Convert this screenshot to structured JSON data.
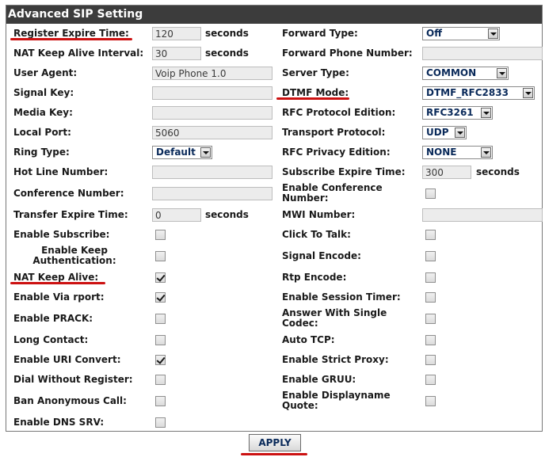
{
  "title": "Advanced SIP Setting",
  "left": {
    "register_expire_time": {
      "label": "Register Expire Time:",
      "value": "120",
      "unit": "seconds"
    },
    "nat_keep_alive_interval": {
      "label": "NAT Keep Alive Interval:",
      "value": "30",
      "unit": "seconds"
    },
    "user_agent": {
      "label": "User Agent:",
      "value": "Voip Phone 1.0"
    },
    "signal_key": {
      "label": "Signal Key:",
      "value": ""
    },
    "media_key": {
      "label": "Media Key:",
      "value": ""
    },
    "local_port": {
      "label": "Local Port:",
      "value": "5060"
    },
    "ring_type": {
      "label": "Ring Type:",
      "value": "Default"
    },
    "hot_line_number": {
      "label": "Hot Line Number:",
      "value": ""
    },
    "conference_number": {
      "label": "Conference Number:",
      "value": ""
    },
    "transfer_expire_time": {
      "label": "Transfer Expire Time:",
      "value": "0",
      "unit": "seconds"
    },
    "enable_subscribe": {
      "label": "Enable Subscribe:",
      "checked": false
    },
    "enable_keep_authentication": {
      "label": "Enable Keep Authentication:",
      "checked": false
    },
    "nat_keep_alive": {
      "label": "NAT Keep Alive:",
      "checked": true
    },
    "enable_via_rport": {
      "label": "Enable Via rport:",
      "checked": true
    },
    "enable_prack": {
      "label": "Enable PRACK:",
      "checked": false
    },
    "long_contact": {
      "label": "Long Contact:",
      "checked": false
    },
    "enable_uri_convert": {
      "label": "Enable URI Convert:",
      "checked": true
    },
    "dial_without_register": {
      "label": "Dial Without Register:",
      "checked": false
    },
    "ban_anonymous_call": {
      "label": "Ban Anonymous Call:",
      "checked": false
    },
    "enable_dns_srv": {
      "label": "Enable DNS SRV:",
      "checked": false
    }
  },
  "right": {
    "forward_type": {
      "label": "Forward Type:",
      "value": "Off"
    },
    "forward_phone_number": {
      "label": "Forward Phone Number:",
      "value": ""
    },
    "server_type": {
      "label": "Server Type:",
      "value": "COMMON"
    },
    "dtmf_mode": {
      "label": "DTMF Mode:",
      "value": "DTMF_RFC2833"
    },
    "rfc_protocol_edition": {
      "label": "RFC Protocol Edition:",
      "value": "RFC3261"
    },
    "transport_protocol": {
      "label": "Transport Protocol:",
      "value": "UDP"
    },
    "rfc_privacy_edition": {
      "label": "RFC Privacy Edition:",
      "value": "NONE"
    },
    "subscribe_expire_time": {
      "label": "Subscribe Expire Time:",
      "value": "300",
      "unit": "seconds"
    },
    "enable_conference_number": {
      "label": "Enable Conference Number:",
      "checked": false
    },
    "mwi_number": {
      "label": "MWI Number:",
      "value": ""
    },
    "click_to_talk": {
      "label": "Click To Talk:",
      "checked": false
    },
    "signal_encode": {
      "label": "Signal Encode:",
      "checked": false
    },
    "rtp_encode": {
      "label": "Rtp Encode:",
      "checked": false
    },
    "enable_session_timer": {
      "label": "Enable Session Timer:",
      "checked": false
    },
    "answer_with_single_codec": {
      "label": "Answer With Single Codec:",
      "checked": false
    },
    "auto_tcp": {
      "label": "Auto TCP:",
      "checked": false
    },
    "enable_strict_proxy": {
      "label": "Enable Strict Proxy:",
      "checked": false
    },
    "enable_gruu": {
      "label": "Enable GRUU:",
      "checked": false
    },
    "enable_displayname_quote": {
      "label": "Enable Displayname Quote:",
      "checked": false
    }
  },
  "apply_label": "APPLY",
  "colors": {
    "header_bg": "#3c3c3c",
    "highlight_underline": "#cc1111",
    "select_text": "#0a2a5a"
  }
}
